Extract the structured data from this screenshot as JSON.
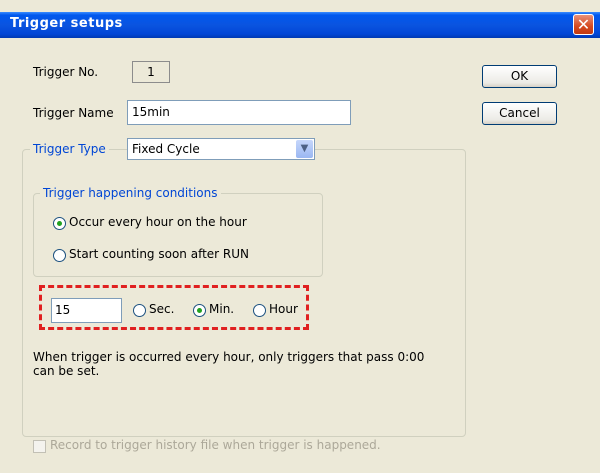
{
  "dialog": {
    "title": "Trigger setups",
    "close_icon": "close-icon"
  },
  "fields": {
    "trigger_no_label": "Trigger No.",
    "trigger_no_value": "1",
    "trigger_name_label": "Trigger Name",
    "trigger_name_value": "15min",
    "trigger_type_label": "Trigger Type",
    "trigger_type_value": "Fixed Cycle"
  },
  "buttons": {
    "ok": "OK",
    "cancel": "Cancel"
  },
  "conditions": {
    "legend": "Trigger happening conditions",
    "option_hour": "Occur every hour on the hour",
    "option_run": "Start counting soon after RUN",
    "selected": "option_hour"
  },
  "interval": {
    "value": "15",
    "sec_label": "Sec.",
    "min_label": "Min.",
    "hour_label": "Hour",
    "selected_unit": "Min."
  },
  "note": "When trigger is occurred every hour, only triggers that pass 0:00 can be set.",
  "history_checkbox_label": "Record to trigger history file when trigger is happened.",
  "colors": {
    "title_bar": "#0a54e0",
    "accent_legend": "#0046d5",
    "highlight_dashed": "#e02020"
  }
}
